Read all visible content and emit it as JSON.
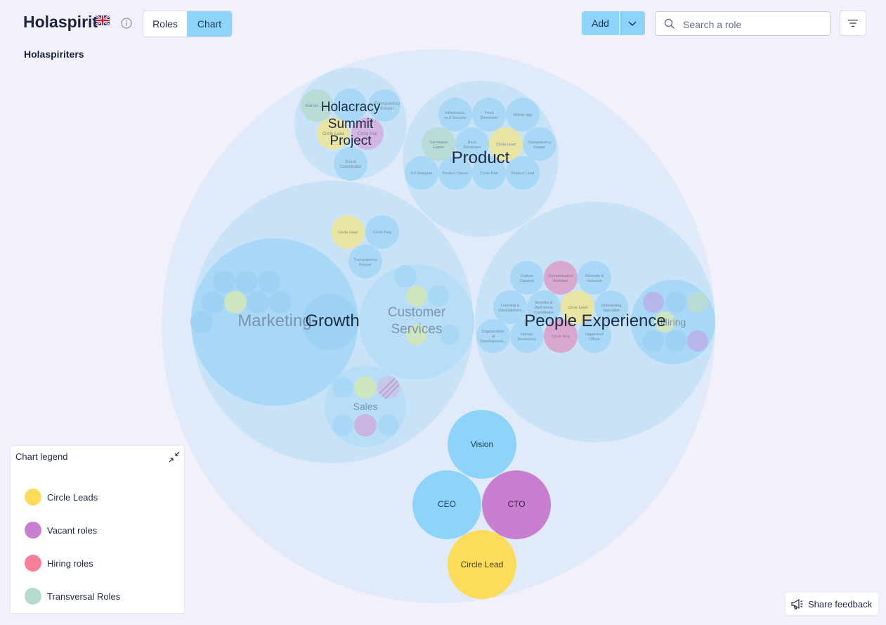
{
  "header": {
    "app_title": "Holaspirit",
    "view_tabs": [
      "Roles",
      "Chart"
    ],
    "active_tab": "Chart",
    "add_label": "Add",
    "search_placeholder": "Search a role",
    "org_name": "Holaspiriters"
  },
  "colors": {
    "accent": "#8ed4fa",
    "circle_lead": "#fddc5c",
    "vacant": "#c97fd0",
    "hiring": "#f67f9a",
    "transversal": "#b5dbd0"
  },
  "chart_labels": {
    "holacracy_summit": [
      "Holacracy",
      "Summit",
      "Project"
    ],
    "product": "Product",
    "growth": "Growth",
    "marketing": "Marketing",
    "customer_services": [
      "Customer",
      "Services"
    ],
    "sales": "Sales",
    "people_experience": "People Experience",
    "hiring": "Hiring",
    "vision": "Vision",
    "ceo": "CEO",
    "cto": "CTO",
    "circle_lead": "Circle Lead",
    "small_roles": {
      "hs_1": "Market...",
      "hs_2": "Transparency Keeper",
      "hs_3": "Circle Lead",
      "hs_4": "Circle Rep",
      "hs_5": [
        "Event",
        "Coordinator"
      ],
      "p_1": [
        "Infrastructu-",
        "re & Security"
      ],
      "p_2": [
        "Front",
        "Developer"
      ],
      "p_3": "Mobile app",
      "p_4": [
        "Translation",
        "Expert"
      ],
      "p_5": [
        "Back",
        "Developer"
      ],
      "p_6": "Circle Lead",
      "p_7": [
        "Transparency",
        "Keeper"
      ],
      "p_8": "UX Designer",
      "p_9": "Product Owner",
      "p_10": "Circle Rep",
      "p_11": "Product Lead",
      "g_1": "Circle Lead",
      "g_2": "Circle Rep",
      "g_3": [
        "Transparency",
        "Keeper"
      ],
      "pe_1": [
        "Culture",
        "Catalyst"
      ],
      "pe_2": [
        "Compensation",
        "Architect"
      ],
      "pe_3": [
        "Diversity &",
        "Inclusion"
      ],
      "pe_4": [
        "Learning &",
        "Development"
      ],
      "pe_5": [
        "Benefits &",
        "Well-being",
        "Coordinator"
      ],
      "pe_6": "Circle Lead",
      "pe_7": [
        "Onboarding",
        "Specialist"
      ],
      "pe_8": [
        "Organization-",
        "al",
        "Development..."
      ],
      "pe_9": [
        "Human",
        "Resources"
      ],
      "pe_10": "Circle Rep",
      "pe_11": [
        "Happiness",
        "Officer"
      ]
    }
  },
  "legend": {
    "title": "Chart legend",
    "items": [
      {
        "label": "Circle Leads",
        "color": "#fddc5c"
      },
      {
        "label": "Vacant roles",
        "color": "#c97fd0"
      },
      {
        "label": "Hiring roles",
        "color": "#f67f9a"
      },
      {
        "label": "Transversal Roles",
        "color": "#b5dbd0"
      }
    ]
  },
  "feedback": {
    "label": "Share feedback"
  },
  "icons": {
    "flag": "uk-flag-icon",
    "info": "info-icon",
    "caret": "chevron-down-icon",
    "search": "search-icon",
    "filter": "filter-icon",
    "collapse": "collapse-icon",
    "feedback": "megaphone-icon"
  }
}
